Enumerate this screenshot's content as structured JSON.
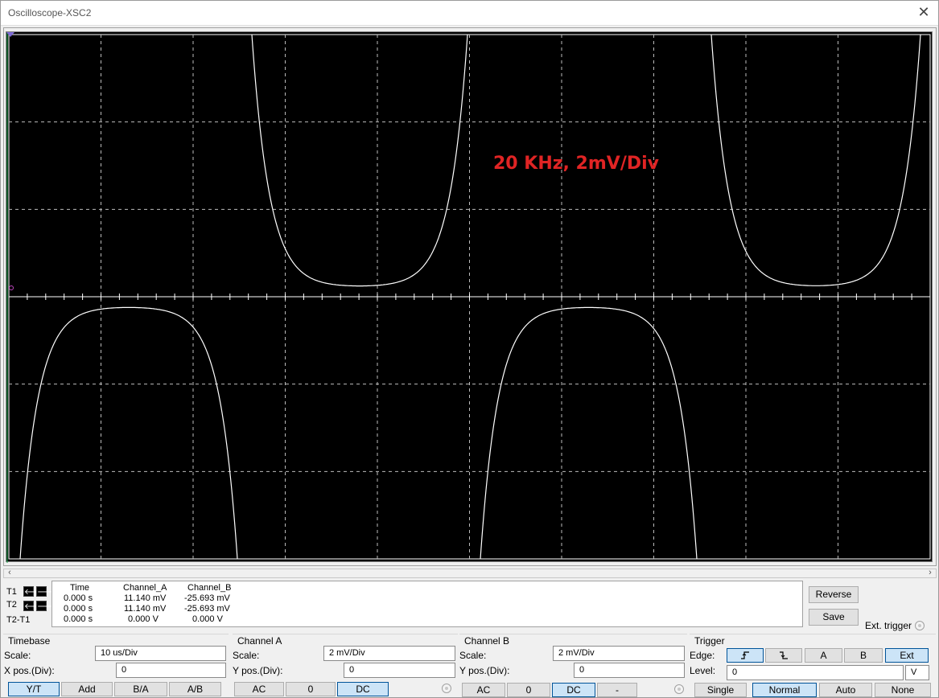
{
  "window": {
    "title": "Oscilloscope-XSC2",
    "close_glyph": "✕"
  },
  "screen": {
    "annotation": "20 KHz, 2mV/Div",
    "annotation_color": "#e02424",
    "background": "#000000",
    "trace_color": "#ffffff"
  },
  "scrollbar": {
    "left_glyph": "‹",
    "right_glyph": "›"
  },
  "cursors": {
    "rows": [
      "T1",
      "T2",
      "T2-T1"
    ],
    "headers": [
      "Time",
      "Channel_A",
      "Channel_B"
    ],
    "values": [
      [
        "0.000 s",
        "11.140 mV",
        "-25.693 mV"
      ],
      [
        "0.000 s",
        "11.140 mV",
        "-25.693 mV"
      ],
      [
        "0.000 s",
        "0.000 V",
        "0.000 V"
      ]
    ],
    "arrow_left": "🡐",
    "arrow_right": "🡒"
  },
  "side_buttons": {
    "reverse": "Reverse",
    "save": "Save",
    "ext_trigger": "Ext. trigger"
  },
  "timebase": {
    "title": "Timebase",
    "scale_label": "Scale:",
    "scale_value": "10 us/Div",
    "xpos_label": "X pos.(Div):",
    "xpos_value": "0",
    "buttons": [
      "Y/T",
      "Add",
      "B/A",
      "A/B"
    ],
    "active": "Y/T"
  },
  "channel_a": {
    "title": "Channel A",
    "scale_label": "Scale:",
    "scale_value": "2 mV/Div",
    "ypos_label": "Y pos.(Div):",
    "ypos_value": "0",
    "buttons": [
      "AC",
      "0",
      "DC"
    ],
    "active": "DC"
  },
  "channel_b": {
    "title": "Channel B",
    "scale_label": "Scale:",
    "scale_value": "2 mV/Div",
    "ypos_label": "Y pos.(Div):",
    "ypos_value": "0",
    "buttons": [
      "AC",
      "0",
      "DC",
      "-"
    ],
    "active": "DC"
  },
  "trigger": {
    "title": "Trigger",
    "edge_label": "Edge:",
    "edge_buttons": [
      "rising-edge-icon",
      "falling-edge-icon",
      "A",
      "B",
      "Ext"
    ],
    "edge_active": [
      "rising-edge-icon",
      "Ext"
    ],
    "level_label": "Level:",
    "level_value": "0",
    "level_unit": "V",
    "mode_buttons": [
      "Single",
      "Normal",
      "Auto",
      "None"
    ],
    "mode_active": "Normal"
  }
}
